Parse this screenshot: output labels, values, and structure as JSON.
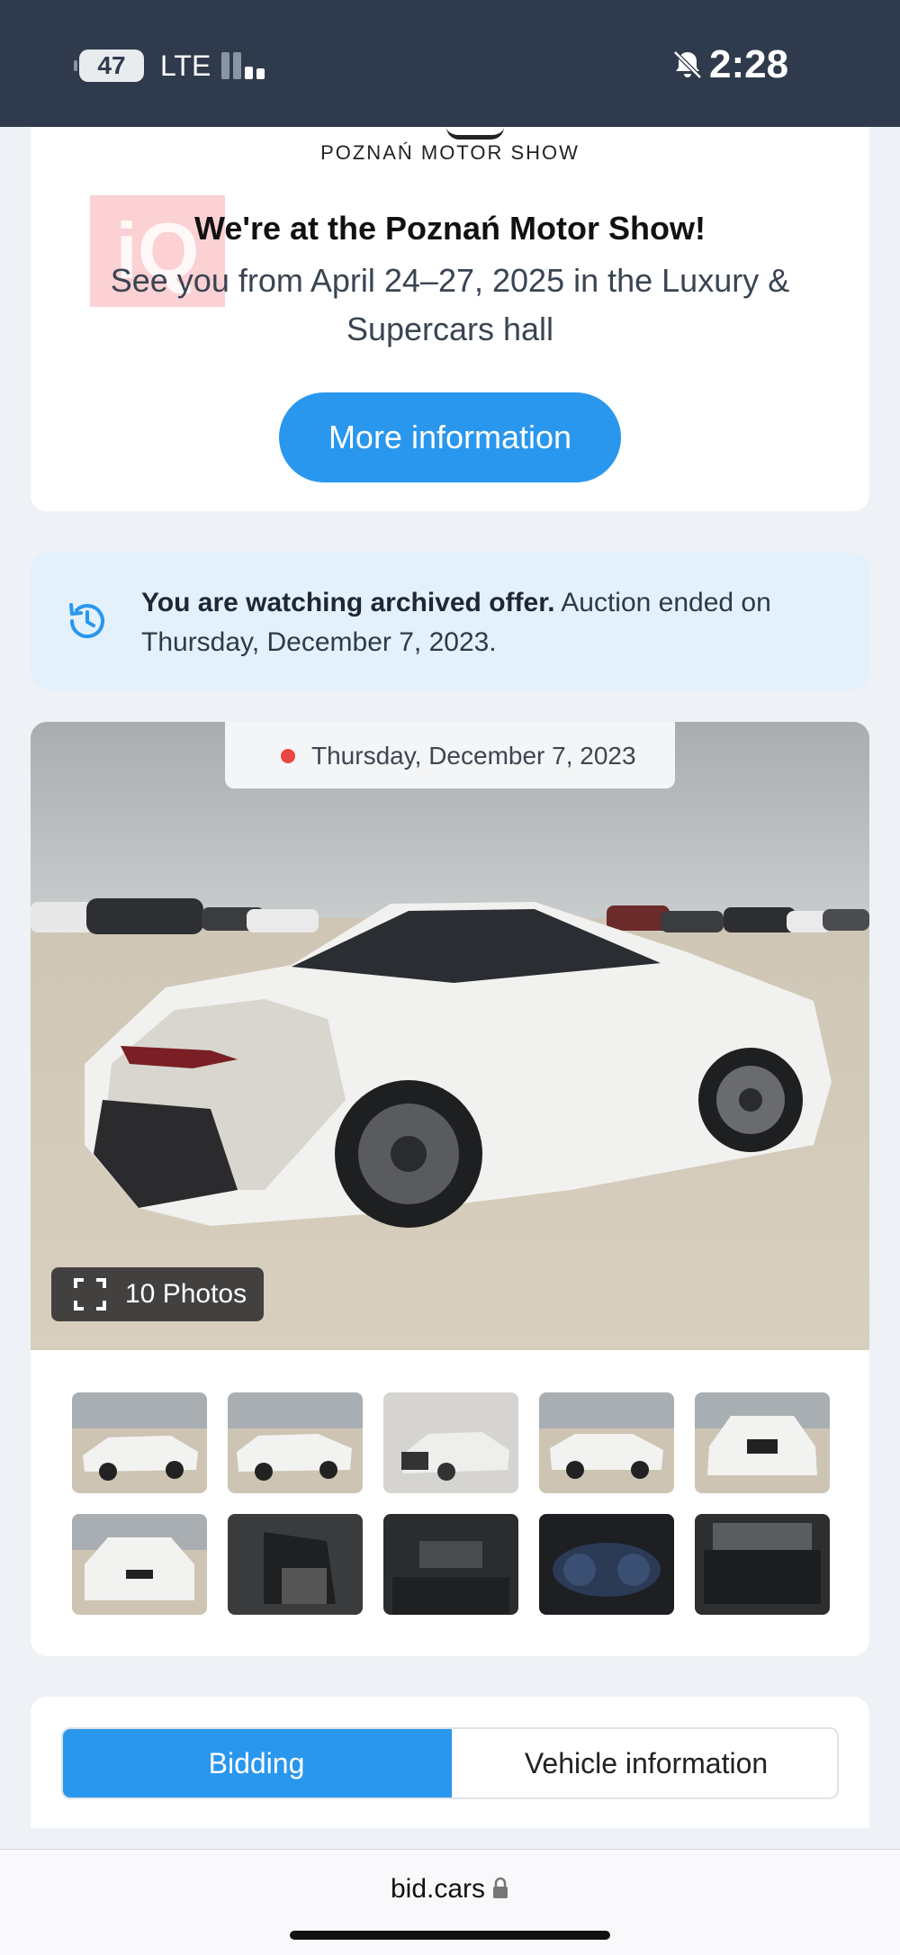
{
  "status_bar": {
    "battery": "47",
    "network": "LTE",
    "time": "2:28",
    "icons": [
      "battery-icon",
      "signal-icon",
      "bell-off-icon"
    ]
  },
  "promo": {
    "logo_text": "POZNAŃ MOTOR SHOW",
    "watermark": "iQ",
    "headline": "We're at the Poznań Motor Show!",
    "subline": "See you from April 24–27, 2025 in the Luxury & Supercars hall",
    "button_label": "More information",
    "button_color": "#2a97ee"
  },
  "notice": {
    "icon": "history-icon",
    "bold_text": "You are watching archived offer.",
    "text": " Auction ended on Thursday, December 7, 2023."
  },
  "gallery": {
    "date_label": "Thursday, December 7, 2023",
    "status_dot_color": "#e84545",
    "photos_label": "10 Photos",
    "thumbnails": [
      {
        "name": "thumb-1"
      },
      {
        "name": "thumb-2"
      },
      {
        "name": "thumb-3"
      },
      {
        "name": "thumb-4"
      },
      {
        "name": "thumb-5"
      },
      {
        "name": "thumb-6"
      },
      {
        "name": "thumb-7"
      },
      {
        "name": "thumb-8"
      },
      {
        "name": "thumb-9"
      },
      {
        "name": "thumb-10"
      }
    ]
  },
  "tabs": {
    "active": "Bidding",
    "inactive": "Vehicle information"
  },
  "browser": {
    "domain": "bid.cars",
    "icon": "lock-icon"
  }
}
